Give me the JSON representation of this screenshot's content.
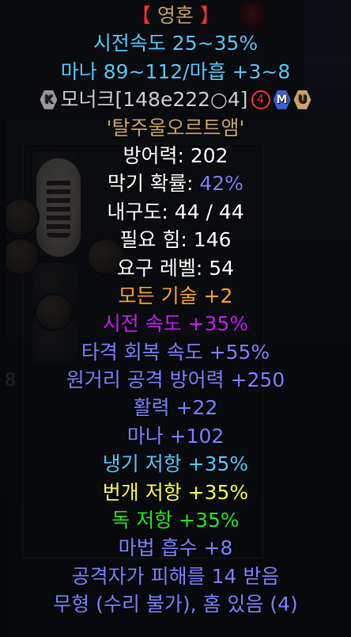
{
  "item": {
    "name_open": "【",
    "name": " 영혼 ",
    "name_close": "】",
    "speed_line": "시전속도 25~35%",
    "mana_line": "마나 89~112/마흡 +3~8",
    "tag_code": "모너크[148e222○4]",
    "tag_badges": {
      "k": "K",
      "sockets": "4",
      "m": "M",
      "u": "U"
    },
    "runeword": "'탈주울오르트앰'",
    "defense_label": "방어력: ",
    "defense_value": "202",
    "block_label": "막기 확률: ",
    "block_value": "42%",
    "durability": "내구도: 44 / 44",
    "strength": "필요 힘: 146",
    "level": "요구 레벨: 54",
    "mods": [
      {
        "text": "모든 기술 +2",
        "color": "orange"
      },
      {
        "text": "시전 속도 +35%",
        "color": "purple"
      },
      {
        "text": "타격 회복 속도 +55%",
        "color": "blue"
      },
      {
        "text": "원거리 공격 방어력 +250",
        "color": "blue"
      },
      {
        "text": "활력 +22",
        "color": "blue"
      },
      {
        "text": "마나 +102",
        "color": "blue"
      },
      {
        "text": "냉기 저항 +35%",
        "color": "cyan"
      },
      {
        "text": "번개 저항 +35%",
        "color": "yellow"
      },
      {
        "text": "독 저항 +35%",
        "color": "green"
      },
      {
        "text": "마법 흡수 +8",
        "color": "blue"
      },
      {
        "text": "공격자가 피해를 14 받음",
        "color": "blue"
      },
      {
        "text": "무형 (수리 불가), 홈 있음 (4)",
        "color": "blue"
      }
    ]
  },
  "background": {
    "inventory_count": "8"
  },
  "colors": {
    "white": "#ffffff",
    "blue": "#7c82ff",
    "cyan": "#58c8ff",
    "gold": "#c9a567",
    "orange": "#ffa81c",
    "purple": "#c81cff",
    "yellow": "#ffff4a",
    "green": "#22e822",
    "red": "#ff3030"
  }
}
